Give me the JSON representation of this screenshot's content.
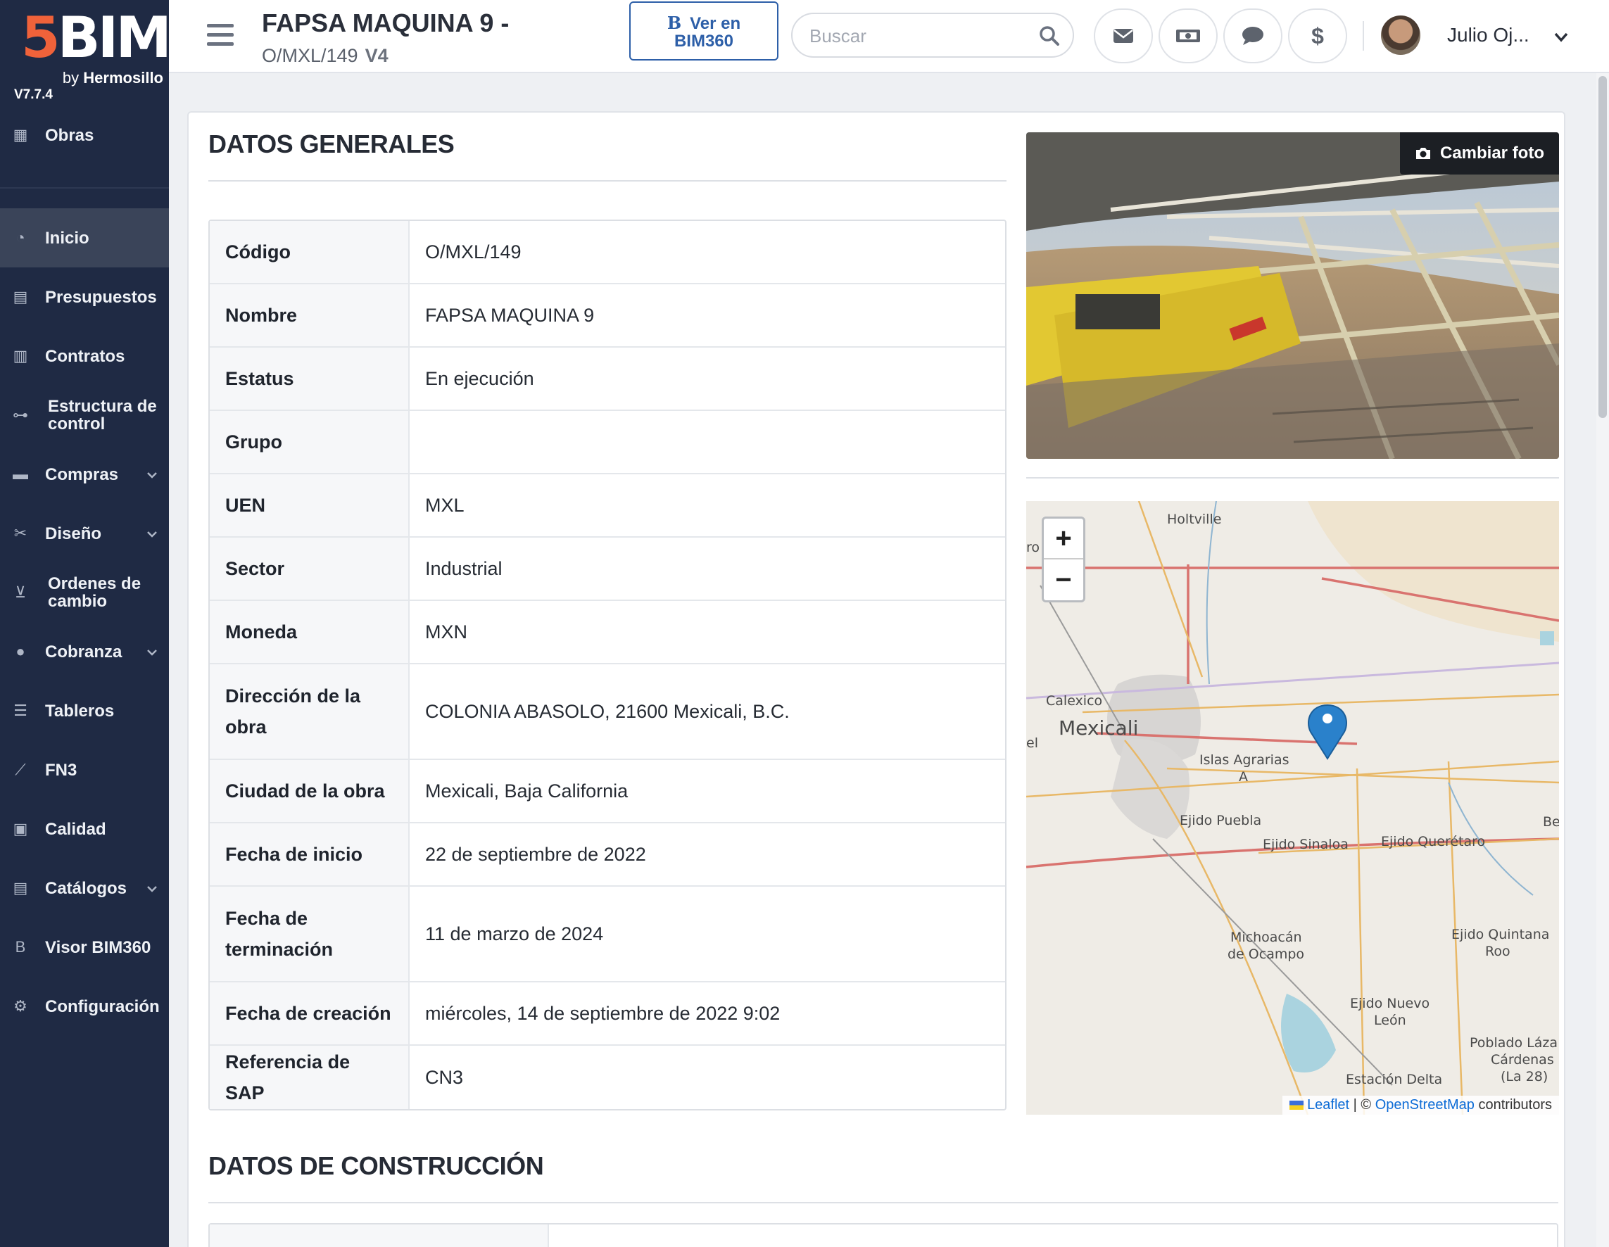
{
  "brand": {
    "five": "5",
    "bim": "BIM",
    "by": "by",
    "by_name": "Hermosillo",
    "version": "V7.7.4"
  },
  "sidebar": {
    "items": [
      {
        "label": "Obras",
        "icon": "building-icon",
        "chevron": false
      },
      {
        "label": "Inicio",
        "icon": "pie-chart-icon",
        "chevron": false,
        "active": true
      },
      {
        "label": "Presupuestos",
        "icon": "calculator-icon",
        "chevron": false
      },
      {
        "label": "Contratos",
        "icon": "document-icon",
        "chevron": false
      },
      {
        "label": "Estructura de control",
        "icon": "sitemap-icon",
        "chevron": false
      },
      {
        "label": "Compras",
        "icon": "credit-card-icon",
        "chevron": true
      },
      {
        "label": "Diseño",
        "icon": "tools-icon",
        "chevron": true
      },
      {
        "label": "Ordenes de cambio",
        "icon": "cart-icon",
        "chevron": false
      },
      {
        "label": "Cobranza",
        "icon": "piggy-bank-icon",
        "chevron": true
      },
      {
        "label": "Tableros",
        "icon": "list-check-icon",
        "chevron": false
      },
      {
        "label": "FN3",
        "icon": "line-chart-icon",
        "chevron": false
      },
      {
        "label": "Calidad",
        "icon": "clipboard-check-icon",
        "chevron": false
      },
      {
        "label": "Catálogos",
        "icon": "book-icon",
        "chevron": true
      },
      {
        "label": "Visor BIM360",
        "icon": "bim-b-icon",
        "chevron": false
      },
      {
        "label": "Configuración",
        "icon": "gears-icon",
        "chevron": false
      }
    ]
  },
  "header": {
    "title": "FAPSA MAQUINA 9 -",
    "code": "O/MXL/149",
    "version": "V4",
    "bim_button_b": "B",
    "bim_button_line1": "Ver en",
    "bim_button_line2": "BIM360",
    "search_placeholder": "Buscar",
    "user_name": "Julio Oj...",
    "icons": [
      "envelope-icon",
      "money-bill-icon",
      "comment-icon",
      "dollar-icon"
    ]
  },
  "general": {
    "title": "DATOS GENERALES",
    "rows": [
      {
        "label": "Código",
        "value": "O/MXL/149"
      },
      {
        "label": "Nombre",
        "value": "FAPSA MAQUINA 9"
      },
      {
        "label": "Estatus",
        "value": "En ejecución"
      },
      {
        "label": "Grupo",
        "value": ""
      },
      {
        "label": "UEN",
        "value": "MXL"
      },
      {
        "label": "Sector",
        "value": "Industrial"
      },
      {
        "label": "Moneda",
        "value": "MXN"
      },
      {
        "label": "Dirección de la obra",
        "value": "COLONIA ABASOLO, 21600 Mexicali, B.C."
      },
      {
        "label": "Ciudad de la obra",
        "value": "Mexicali, Baja California"
      },
      {
        "label": "Fecha de inicio",
        "value": "22 de septiembre de 2022"
      },
      {
        "label": "Fecha de terminación",
        "value": "11 de marzo de 2024"
      },
      {
        "label": "Fecha de creación",
        "value": "miércoles, 14 de septiembre de 2022 9:02"
      },
      {
        "label": "Referencia de SAP",
        "value": "CN3"
      }
    ],
    "photo_button": "Cambiar foto"
  },
  "map": {
    "zoom_in": "+",
    "zoom_out": "−",
    "labels": {
      "holtville": "Holtville",
      "ro": "ro",
      "calexico": "Calexico",
      "mexicali": "Mexicali",
      "el": "el",
      "islas": "Islas Agrarias",
      "islas_a": "A",
      "puebla": "Ejido Puebla",
      "sinaloa": "Ejido Sinaloa",
      "queretaro": "Ejido Querétaro",
      "be": "Be",
      "michoacan1": "Michoacán",
      "michoacan2": "de Ocampo",
      "quintana1": "Ejido Quintana",
      "quintana2": "Roo",
      "nuevo1": "Ejido Nuevo",
      "nuevo2": "León",
      "poblado1": "Poblado Láza",
      "poblado2": "Cárdenas",
      "poblado3": "(La 28)",
      "estacion": "Estación Delta"
    },
    "attribution_leaflet": "Leaflet",
    "attribution_sep": " | © ",
    "attribution_osm": "OpenStreetMap",
    "attribution_tail": " contributors"
  },
  "construction": {
    "title": "DATOS DE CONSTRUCCIÓN"
  },
  "colors": {
    "sidebar": "#1f2a44",
    "accent": "#f0623a",
    "bim_blue": "#2d5fa8",
    "marker": "#2a81cb"
  }
}
